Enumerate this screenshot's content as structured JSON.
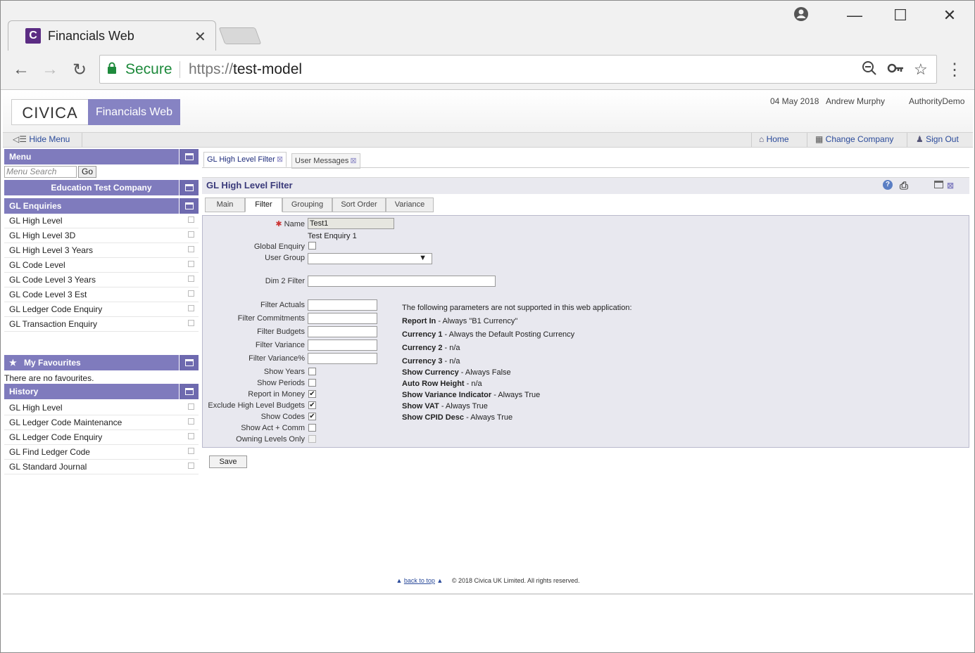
{
  "browser": {
    "tab_title": "Financials Web",
    "favicon_letter": "C",
    "secure_label": "Secure",
    "url_scheme": "https://",
    "url_host": "test-model"
  },
  "header": {
    "logo_text": "CIVICA",
    "app_title": "Financials Web",
    "date": "04 May 2018",
    "user": "Andrew Murphy",
    "authority": "AuthorityDemo"
  },
  "toolbar": {
    "hide_menu": "Hide Menu",
    "home": "Home",
    "change_company": "Change Company",
    "sign_out": "Sign Out"
  },
  "sidebar": {
    "menu_title": "Menu",
    "search_placeholder": "Menu Search",
    "go_label": "Go",
    "company": "Education Test Company",
    "section_title": "GL Enquiries",
    "items": [
      "GL High Level",
      "GL High Level 3D",
      "GL High Level 3 Years",
      "GL Code Level",
      "GL Code Level 3 Years",
      "GL Code Level 3 Est",
      "GL Ledger Code Enquiry",
      "GL Transaction Enquiry"
    ],
    "favourites_title": "My Favourites",
    "favourites_empty": "There are no favourites.",
    "history_title": "History",
    "history": [
      "GL High Level",
      "GL Ledger Code Maintenance",
      "GL Ledger Code Enquiry",
      "GL Find Ledger Code",
      "GL Standard Journal"
    ]
  },
  "content": {
    "tabs": [
      "GL High Level Filter",
      "User Messages"
    ],
    "page_title": "GL High Level Filter",
    "subtabs": [
      "Main",
      "Filter",
      "Grouping",
      "Sort Order",
      "Variance"
    ],
    "active_subtab": "Filter"
  },
  "form": {
    "name_label": "Name",
    "name_value": "Test1",
    "description": "Test Enquiry 1",
    "global_enquiry_label": "Global Enquiry",
    "user_group_label": "User Group",
    "user_group_value": "",
    "dim2_label": "Dim 2 Filter",
    "dim2_value": "",
    "filters": [
      "Filter Actuals",
      "Filter Commitments",
      "Filter Budgets",
      "Filter Variance",
      "Filter Variance%"
    ],
    "checkboxes": [
      {
        "label": "Show Years",
        "checked": false,
        "disabled": false
      },
      {
        "label": "Show Periods",
        "checked": false,
        "disabled": false
      },
      {
        "label": "Report in Money",
        "checked": true,
        "disabled": false
      },
      {
        "label": "Exclude High Level Budgets",
        "checked": true,
        "disabled": false
      },
      {
        "label": "Show Codes",
        "checked": true,
        "disabled": false
      },
      {
        "label": "Show Act + Comm",
        "checked": false,
        "disabled": false
      },
      {
        "label": "Owning Levels Only",
        "checked": false,
        "disabled": true
      }
    ],
    "save_label": "Save"
  },
  "notes": {
    "intro": "The following parameters are not supported in this web application:",
    "items": [
      {
        "key": "Report In",
        "value": " - Always \"B1 Currency\""
      },
      {
        "key": "Currency 1",
        "value": " - Always the Default Posting Currency"
      },
      {
        "key": "Currency 2",
        "value": " - n/a"
      },
      {
        "key": "Currency 3",
        "value": " - n/a"
      },
      {
        "key": "Show Currency",
        "value": " - Always False"
      },
      {
        "key": "Auto Row Height",
        "value": " - n/a"
      },
      {
        "key": "Show Variance Indicator",
        "value": " - Always True"
      },
      {
        "key": "Show VAT",
        "value": " - Always True"
      },
      {
        "key": "Show CPID Desc",
        "value": " - Always True"
      }
    ]
  },
  "footer": {
    "back_to_top": "back to top",
    "copyright": "© 2018 Civica UK Limited. All rights reserved."
  }
}
